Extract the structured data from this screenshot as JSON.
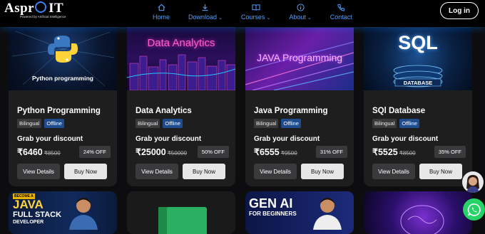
{
  "brand": {
    "name": "Aspro IT",
    "name_left": "Aspr",
    "name_right": "IT",
    "tagline": "Powered by Artificial Intelligence"
  },
  "nav": {
    "items": [
      {
        "label": "Home",
        "icon": "home-icon"
      },
      {
        "label": "Download",
        "icon": "download-icon",
        "caret": "⌄"
      },
      {
        "label": "Courses",
        "icon": "book-icon",
        "caret": "⌄"
      },
      {
        "label": "About",
        "icon": "info-icon",
        "caret": "⌄"
      },
      {
        "label": "Contact",
        "icon": "phone-icon"
      }
    ],
    "login_label": "Log in"
  },
  "courses": [
    {
      "title": "Python Programming",
      "image_text": "Python programming",
      "tags": [
        "Bilingual",
        "Offline"
      ],
      "discount_label": "Grab your discount",
      "price": "₹6460",
      "mrp": "₹8500",
      "off": "24% OFF",
      "view_label": "View Details",
      "buy_label": "Buy Now"
    },
    {
      "title": "Data Analytics",
      "image_text": "Data Analytics",
      "tags": [
        "Bilingual",
        "Offline"
      ],
      "discount_label": "Grab your discount",
      "price": "₹25000",
      "mrp": "₹50000",
      "off": "50% OFF",
      "view_label": "View Details",
      "buy_label": "Buy Now"
    },
    {
      "title": "Java Programming",
      "image_text": "JAVA Programming",
      "tags": [
        "Bilingual",
        "Offline"
      ],
      "discount_label": "Grab your discount",
      "price": "₹6555",
      "mrp": "₹9500",
      "off": "31% OFF",
      "view_label": "View Details",
      "buy_label": "Buy Now"
    },
    {
      "title": "SQl Database",
      "image_text": "SQL",
      "image_subtext": "DATABASE",
      "tags": [
        "Bilingual",
        "Offline"
      ],
      "discount_label": "Grab your discount",
      "price": "₹5525",
      "mrp": "₹8500",
      "off": "35% OFF",
      "view_label": "View Details",
      "buy_label": "Buy Now"
    }
  ],
  "next_row": [
    {
      "line1": "BECOME A",
      "line2": "JAVA",
      "line3": "FULL STACK",
      "line4": "DEVELOPER"
    },
    {},
    {
      "line1": "GEN AI",
      "line2": "FOR BEGINNERS"
    },
    {}
  ],
  "colors": {
    "accent": "#4ea1ff",
    "background": "#0d0d0f",
    "card": "#1e1e1f",
    "offline_tag": "#1f4c8f",
    "whatsapp": "#25d366"
  }
}
